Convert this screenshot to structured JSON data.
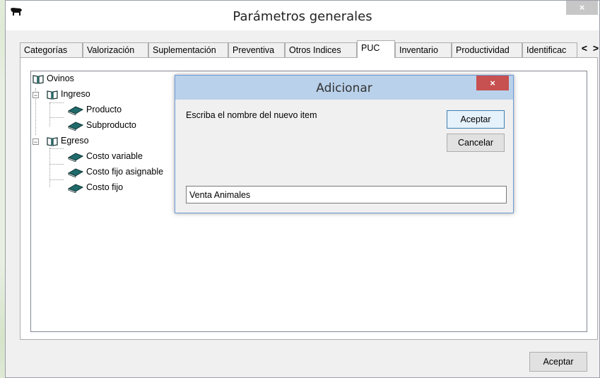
{
  "window": {
    "title": "Parámetros generales",
    "close_label": "×"
  },
  "tabs": [
    {
      "label": "Categorías",
      "active": false
    },
    {
      "label": "Valorización",
      "active": false
    },
    {
      "label": "Suplementación",
      "active": false
    },
    {
      "label": "Preventiva",
      "active": false
    },
    {
      "label": "Otros Indices",
      "active": false
    },
    {
      "label": "PUC",
      "active": true
    },
    {
      "label": "Inventario",
      "active": false
    },
    {
      "label": "Productividad",
      "active": false
    },
    {
      "label": "Identificac",
      "active": false
    }
  ],
  "tab_scroll": {
    "left": "<",
    "right": ">"
  },
  "tree": {
    "root": "Ovinos",
    "groups": [
      {
        "label": "Ingreso",
        "expander": "−",
        "children": [
          "Producto",
          "Subproducto"
        ]
      },
      {
        "label": "Egreso",
        "expander": "−",
        "children": [
          "Costo variable",
          "Costo fijo asignable",
          "Costo fijo"
        ]
      }
    ]
  },
  "footer": {
    "ok_label": "Aceptar"
  },
  "dialog": {
    "title": "Adicionar",
    "close_label": "×",
    "prompt": "Escriba el nombre del nuevo item",
    "accept_label": "Aceptar",
    "cancel_label": "Cancelar",
    "input_value": "Venta Animales"
  },
  "colors": {
    "dialog_title_bg": "#b9d1ea",
    "dialog_close_bg": "#c75050",
    "book_icon": "#1f6b6b"
  }
}
